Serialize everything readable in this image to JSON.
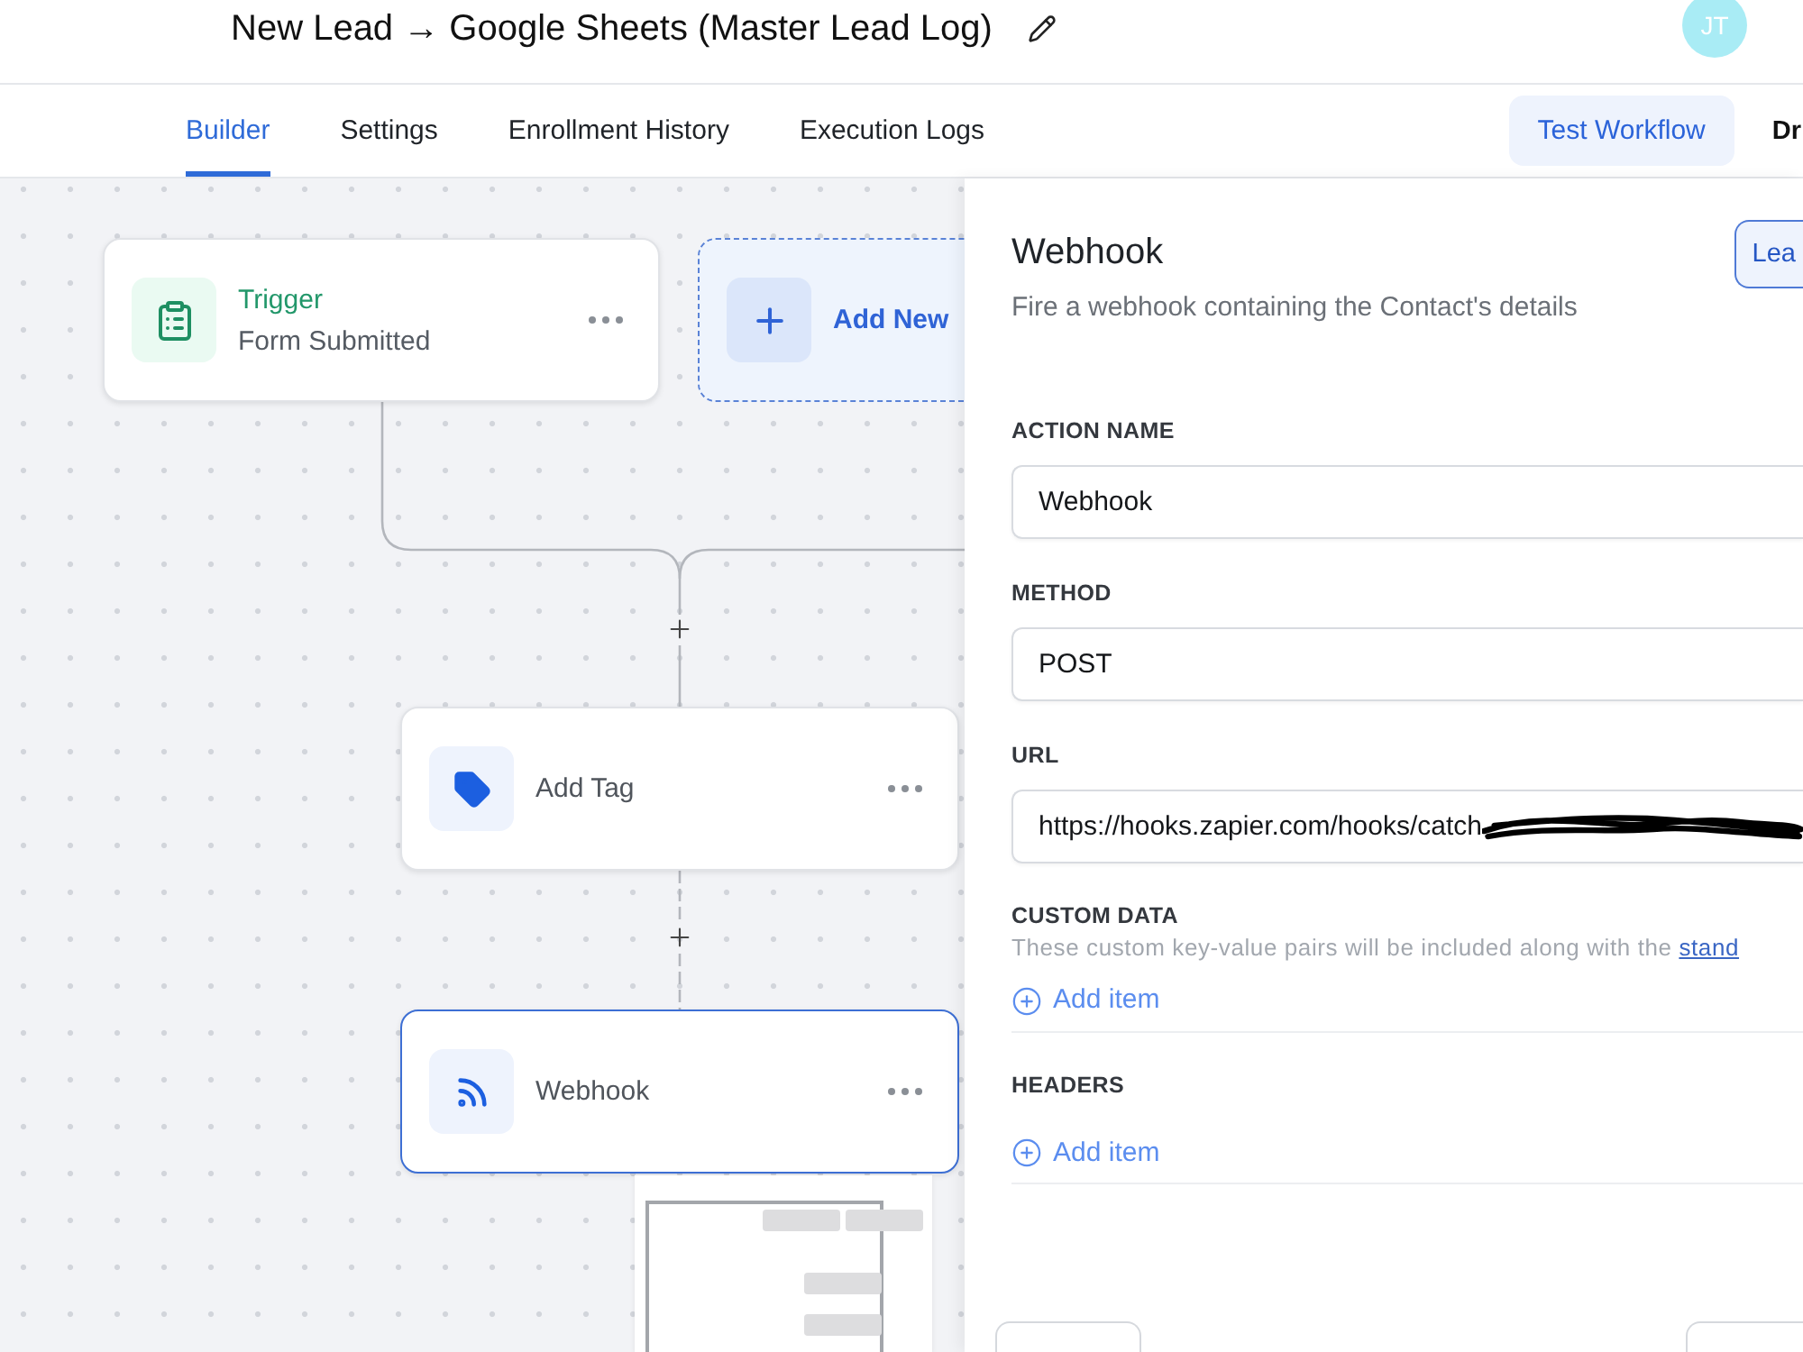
{
  "header": {
    "title": "New Lead → Google Sheets (Master Lead Log)",
    "avatar": "JT"
  },
  "tabs": [
    {
      "label": "Builder",
      "selected": true
    },
    {
      "label": "Settings",
      "selected": false
    },
    {
      "label": "Enrollment History",
      "selected": false
    },
    {
      "label": "Execution Logs",
      "selected": false
    }
  ],
  "actions": {
    "test_button": "Test Workflow",
    "cut_button": "Dr"
  },
  "canvas": {
    "nodes": [
      {
        "kind": "trigger",
        "title": "Trigger",
        "subtitle": "Form Submitted",
        "selected": false
      },
      {
        "kind": "add",
        "title": "Add New",
        "selected": false
      },
      {
        "kind": "tag",
        "title": "Add Tag",
        "selected": false
      },
      {
        "kind": "webhook",
        "title": "Webhook",
        "selected": true
      }
    ]
  },
  "panel": {
    "title": "Webhook",
    "subtitle": "Fire a webhook containing the Contact's details",
    "learn_button": "Lea",
    "fields": [
      {
        "label": "ACTION NAME",
        "value": "Webhook"
      },
      {
        "label": "METHOD",
        "value": "POST"
      },
      {
        "label": "URL",
        "value": "https://hooks.zapier.com/hooks/catch",
        "redacted": true
      }
    ],
    "sections": [
      {
        "label": "CUSTOM DATA",
        "description": "These custom key-value pairs will be included along with the ",
        "link": "stand",
        "add_label": "Add item"
      },
      {
        "label": "HEADERS",
        "add_label": "Add item"
      }
    ]
  }
}
